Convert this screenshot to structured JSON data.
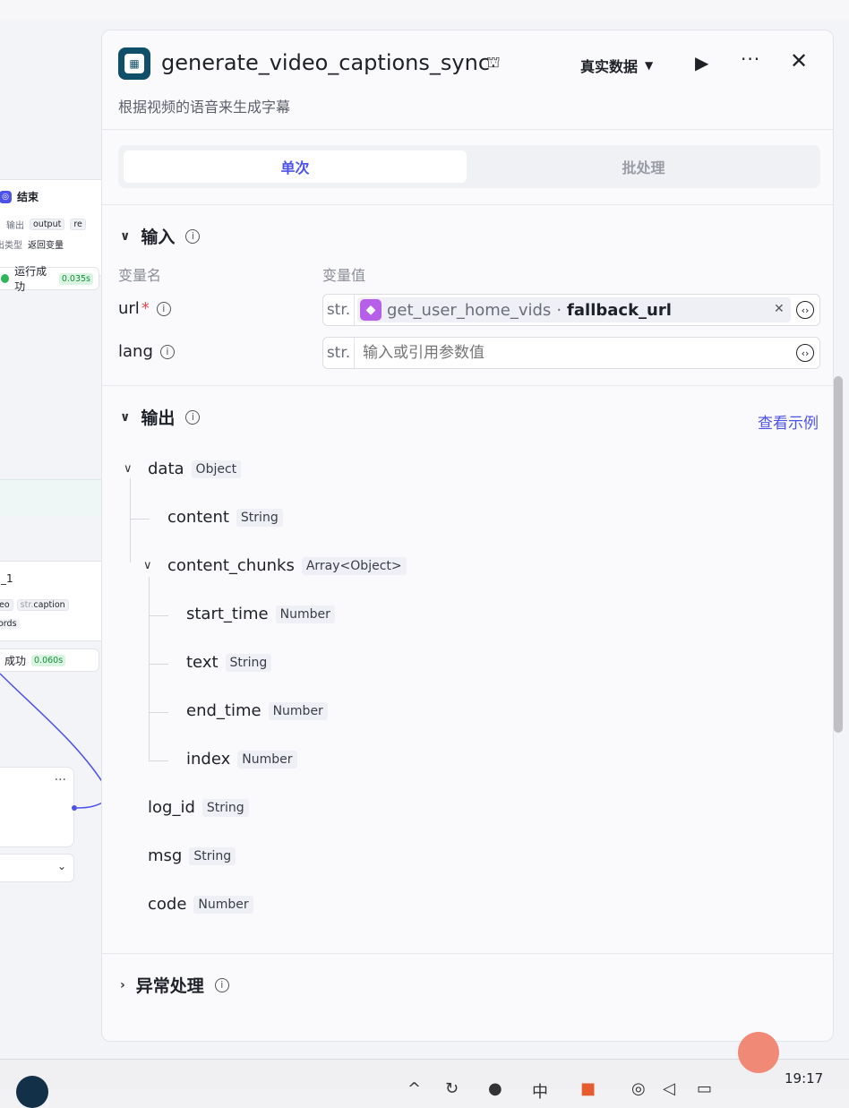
{
  "canvas": {
    "end_node": {
      "title": "结束",
      "row1_label": "输出",
      "row1_chip1": "output",
      "row1_chip2": "re",
      "row2_label": "出类型",
      "row2_value": "返回变量"
    },
    "status1": {
      "text": "运行成功",
      "time": "0.035s"
    },
    "mid_node": {
      "title": "_1",
      "chip1": "eo",
      "chip2": "caption",
      "words": "ords"
    },
    "status2": {
      "text": "成功",
      "time": "0.060s"
    },
    "more": "···"
  },
  "panel": {
    "title": "generate_video_captions_sync",
    "subtitle": "根据视频的语音来生成字幕",
    "mode": "真实数据",
    "tabs": [
      {
        "label": "单次"
      },
      {
        "label": "批处理"
      }
    ],
    "input": {
      "title": "输入",
      "col_name": "变量名",
      "col_value": "变量值",
      "vars": [
        {
          "name": "url",
          "required": "*",
          "type": "str.",
          "ref_plugin": "get_user_home_vids",
          "ref_sep": "·",
          "ref_field": "fallback_url"
        },
        {
          "name": "lang",
          "type": "str.",
          "placeholder": "输入或引用参数值"
        }
      ]
    },
    "output": {
      "title": "输出",
      "example_link": "查看示例",
      "fields": [
        {
          "name": "data",
          "type": "Object"
        },
        {
          "name": "content",
          "type": "String"
        },
        {
          "name": "content_chunks",
          "type": "Array<Object>"
        },
        {
          "name": "start_time",
          "type": "Number"
        },
        {
          "name": "text",
          "type": "String"
        },
        {
          "name": "end_time",
          "type": "Number"
        },
        {
          "name": "index",
          "type": "Number"
        },
        {
          "name": "log_id",
          "type": "String"
        },
        {
          "name": "msg",
          "type": "String"
        },
        {
          "name": "code",
          "type": "Number"
        }
      ]
    },
    "exception": {
      "title": "异常处理"
    }
  },
  "taskbar": {
    "clock": "19:17"
  },
  "colors": {
    "accent": "#4d53e8",
    "success": "#2fb45a",
    "plugin": "#b65fe8"
  }
}
